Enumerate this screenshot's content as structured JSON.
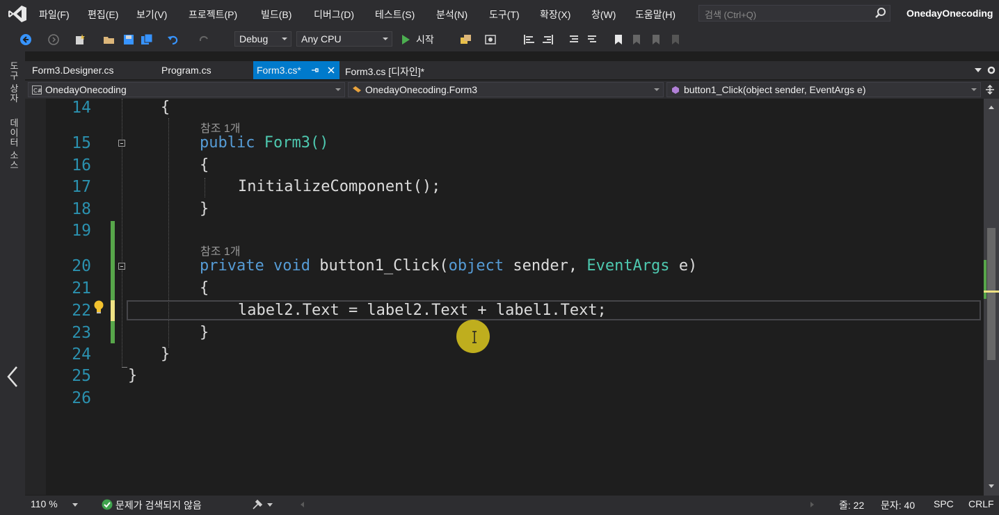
{
  "menu": {
    "items": [
      "파일(F)",
      "편집(E)",
      "보기(V)",
      "프로젝트(P)",
      "빌드(B)",
      "디버그(D)",
      "테스트(S)",
      "분석(N)",
      "도구(T)",
      "확장(X)",
      "창(W)",
      "도움말(H)"
    ],
    "search_placeholder": "검색 (Ctrl+Q)",
    "solution_name": "OnedayOnecoding"
  },
  "toolbar": {
    "config": "Debug",
    "platform": "Any CPU",
    "start_label": "시작"
  },
  "side_panels": [
    "도구 상자",
    "데이터 소스"
  ],
  "tabs": [
    {
      "label": "Form3.Designer.cs"
    },
    {
      "label": "Program.cs"
    },
    {
      "label": "Form3.cs*"
    },
    {
      "label": "Form3.cs [디자인]*"
    }
  ],
  "navbar": {
    "project": "OnedayOnecoding",
    "class": "OnedayOnecoding.Form3",
    "member": "button1_Click(object sender, EventArgs e)"
  },
  "editor": {
    "line_numbers": [
      "14",
      "15",
      "16",
      "17",
      "18",
      "19",
      "20",
      "21",
      "22",
      "23",
      "24",
      "25",
      "26"
    ],
    "codelens": "참조 1개",
    "lines": {
      "l14": "{",
      "l15_kw": "public",
      "l15_rest": "Form3()",
      "l16": "{",
      "l17": "InitializeComponent();",
      "l18": "}",
      "l20_kw1": "private",
      "l20_kw2": "void",
      "l20_name": "button1_Click(",
      "l20_kw3": "object",
      "l20_mid": "sender,",
      "l20_type": "EventArgs",
      "l20_end": "e)",
      "l21": "{",
      "l22": "label2.Text = label2.Text + label1.Text;",
      "l23": "}",
      "l24": "}",
      "l25": "}"
    }
  },
  "status": {
    "zoom": "110 %",
    "issues": "문제가 검색되지 않음",
    "line": "줄: 22",
    "col": "문자: 40",
    "spc": "SPC",
    "crlf": "CRLF"
  },
  "colors": {
    "accent": "#007acc",
    "keyword": "#569cd6",
    "type": "#4ec9b0",
    "line_number": "#2b91af"
  }
}
